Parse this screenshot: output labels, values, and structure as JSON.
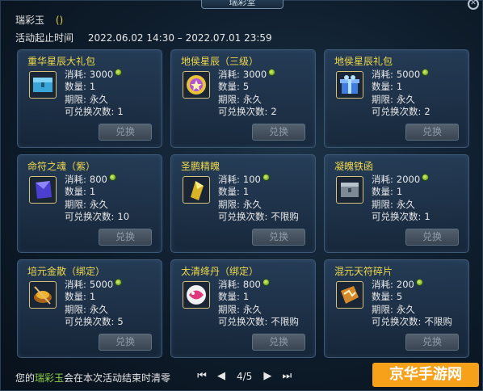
{
  "window": {
    "title": "瑞彩堂",
    "close_icon": "close-icon"
  },
  "header": {
    "currency_label": "瑞彩玉",
    "currency_value": "()",
    "period_label": "活动起止时间",
    "period_value": "2022.06.02 14:30 – 2022.07.01 23:59"
  },
  "labels": {
    "cost": "消耗:",
    "quantity": "数量:",
    "duration": "期限:",
    "redeemable": "可兑换次数:",
    "redeem_button": "兑换"
  },
  "items": [
    {
      "name": "重华星辰大礼包",
      "cost": "3000",
      "quantity": "1",
      "duration": "永久",
      "redeemable": "1",
      "icon": "blue-chest-icon"
    },
    {
      "name": "地侯星辰（三级）",
      "cost": "3000",
      "quantity": "5",
      "duration": "永久",
      "redeemable": "2",
      "icon": "star-orb-icon"
    },
    {
      "name": "地侯星辰礼包",
      "cost": "5000",
      "quantity": "1",
      "duration": "永久",
      "redeemable": "2",
      "icon": "gift-box-icon"
    },
    {
      "name": "命符之魂（紫）",
      "cost": "800",
      "quantity": "1",
      "duration": "永久",
      "redeemable": "10",
      "icon": "purple-crystal-icon"
    },
    {
      "name": "圣鹏精魄",
      "cost": "100",
      "quantity": "1",
      "duration": "永久",
      "redeemable": "不限购",
      "icon": "gold-gem-icon"
    },
    {
      "name": "凝魄铁函",
      "cost": "2000",
      "quantity": "1",
      "duration": "永久",
      "redeemable": "1",
      "icon": "iron-box-icon"
    },
    {
      "name": "培元金散（绑定）",
      "cost": "5000",
      "quantity": "1",
      "duration": "永久",
      "redeemable": "5",
      "icon": "golden-powder-icon"
    },
    {
      "name": "太清绛丹（绑定）",
      "cost": "800",
      "quantity": "1",
      "duration": "永久",
      "redeemable": "不限购",
      "icon": "pill-icon"
    },
    {
      "name": "混元天符碎片",
      "cost": "200",
      "quantity": "5",
      "duration": "永久",
      "redeemable": "不限购",
      "icon": "talisman-shard-icon"
    }
  ],
  "footer": {
    "note_prefix": "您的",
    "note_highlight": "瑞彩玉",
    "note_suffix": "会在本次活动结束时清零",
    "page_indicator": "4/5"
  },
  "watermark": "京华手游网",
  "colors": {
    "item_name": "#f0d94a",
    "highlight": "#8fd24c",
    "card_border": "#3c5978"
  }
}
